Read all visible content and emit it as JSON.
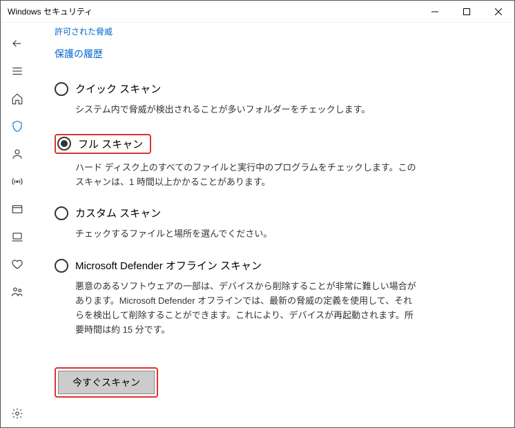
{
  "window": {
    "title": "Windows セキュリティ"
  },
  "links": {
    "allowed": "許可された脅威",
    "history": "保護の履歴"
  },
  "scans": {
    "quick": {
      "label": "クイック スキャン",
      "desc": "システム内で脅威が検出されることが多いフォルダーをチェックします。"
    },
    "full": {
      "label": "フル スキャン",
      "desc": "ハード ディスク上のすべてのファイルと実行中のプログラムをチェックします。このスキャンは、1 時間以上かかることがあります。"
    },
    "custom": {
      "label": "カスタム スキャン",
      "desc": "チェックするファイルと場所を選んでください。"
    },
    "offline": {
      "label": "Microsoft Defender オフライン スキャン",
      "desc": "悪意のあるソフトウェアの一部は、デバイスから削除することが非常に難しい場合があります。Microsoft Defender オフラインでは、最新の脅威の定義を使用して、それらを検出して削除することができます。これにより、デバイスが再起動されます。所要時間は約 15 分です。"
    }
  },
  "button": {
    "scanNow": "今すぐスキャン"
  }
}
